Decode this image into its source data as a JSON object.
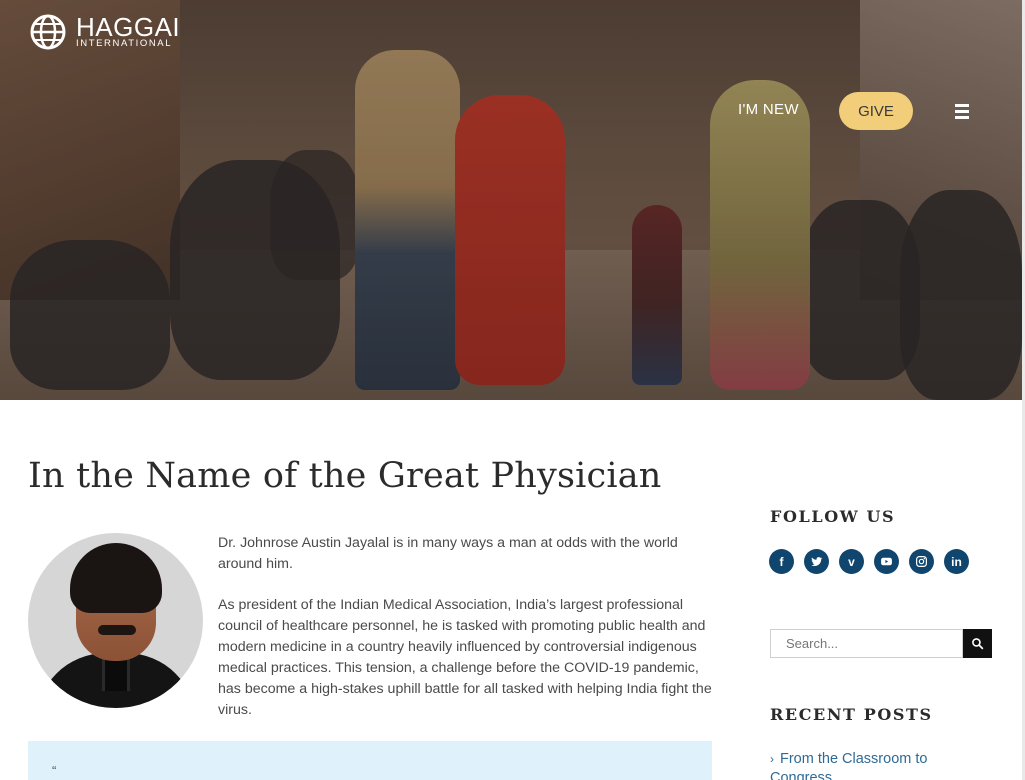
{
  "brand": {
    "name": "HAGGAI",
    "tagline": "INTERNATIONAL"
  },
  "nav": {
    "new_label": "I'M NEW",
    "give_label": "GIVE"
  },
  "article": {
    "title": "In the Name of the Great Physician",
    "paragraphs": [
      "Dr. Johnrose Austin Jayalal is in many ways a man at odds with the world around him.",
      "As president of the Indian Medical Association, India’s largest professional council of healthcare personnel, he is tasked with promoting public health and modern medicine in a country heavily influenced by controversial indigenous medical practices. This tension, a challenge before the COVID-19 pandemic, has become a high-stakes uphill battle for all tasked with helping India fight the virus."
    ],
    "quote_mark": "“"
  },
  "sidebar": {
    "follow_heading": "FOLLOW US",
    "socials": [
      {
        "name": "facebook-icon",
        "glyph": "f"
      },
      {
        "name": "twitter-icon",
        "glyph": "t"
      },
      {
        "name": "vimeo-icon",
        "glyph": "v"
      },
      {
        "name": "youtube-icon",
        "glyph": "▶"
      },
      {
        "name": "instagram-icon",
        "glyph": "◎"
      },
      {
        "name": "linkedin-icon",
        "glyph": "in"
      }
    ],
    "search_placeholder": "Search...",
    "recent_heading": "RECENT POSTS",
    "recent_posts": [
      "From the Classroom to Congress"
    ]
  },
  "colors": {
    "give_bg": "#f2cd7a",
    "social_bg": "#10456e",
    "link": "#2f6a96",
    "quote_bg": "#dff2fc"
  }
}
